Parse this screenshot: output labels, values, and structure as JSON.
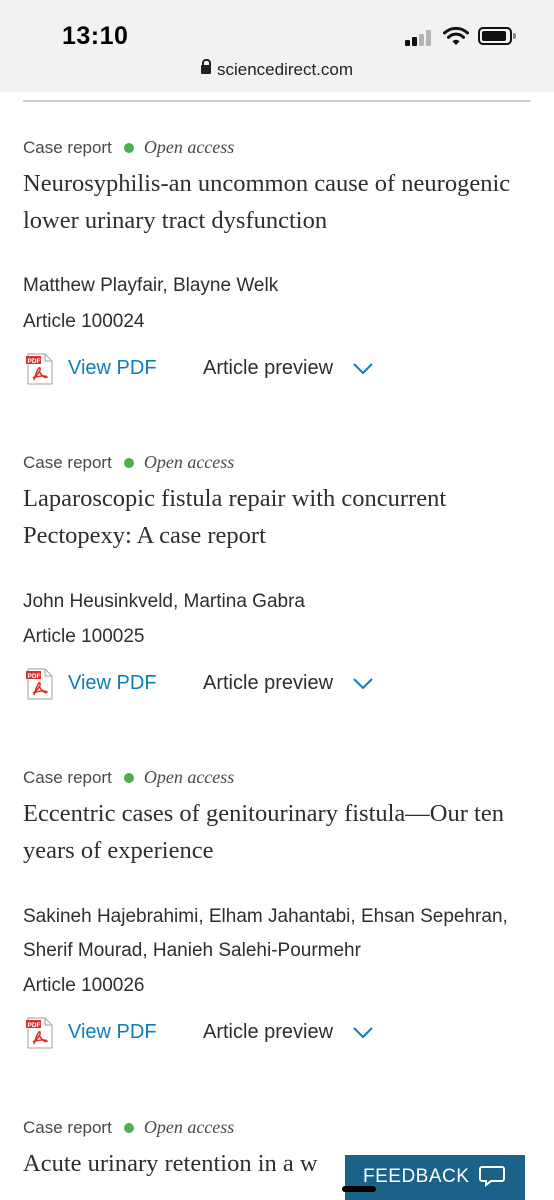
{
  "status": {
    "time": "13:10"
  },
  "browser": {
    "url": "sciencedirect.com"
  },
  "articles": [
    {
      "type": "Case report",
      "access": "Open access",
      "title": "Neurosyphilis-an uncommon cause of neurogenic lower urinary tract dysfunction",
      "authors": "Matthew Playfair, Blayne Welk",
      "article_no": "Article 100024",
      "pdf_label": "View PDF",
      "preview_label": "Article preview"
    },
    {
      "type": "Case report",
      "access": "Open access",
      "title": "Laparoscopic fistula repair with concurrent Pectopexy: A case report",
      "authors": "John Heusinkveld, Martina Gabra",
      "article_no": "Article 100025",
      "pdf_label": "View PDF",
      "preview_label": "Article preview"
    },
    {
      "type": "Case report",
      "access": "Open access",
      "title": "Eccentric cases of genitourinary fistula—Our ten years of experience",
      "authors": "Sakineh Hajebrahimi, Elham Jahantabi, Ehsan Sepehran, Sherif Mourad, Hanieh Salehi-Pourmehr",
      "article_no": "Article 100026",
      "pdf_label": "View PDF",
      "preview_label": "Article preview"
    },
    {
      "type": "Case report",
      "access": "Open access",
      "title": "Acute urinary retention in a w"
    }
  ],
  "feedback": {
    "label": "FEEDBACK"
  },
  "colors": {
    "link": "#0c7dbb",
    "open_access_dot": "#4caf50",
    "feedback_bg": "#1a6288"
  }
}
